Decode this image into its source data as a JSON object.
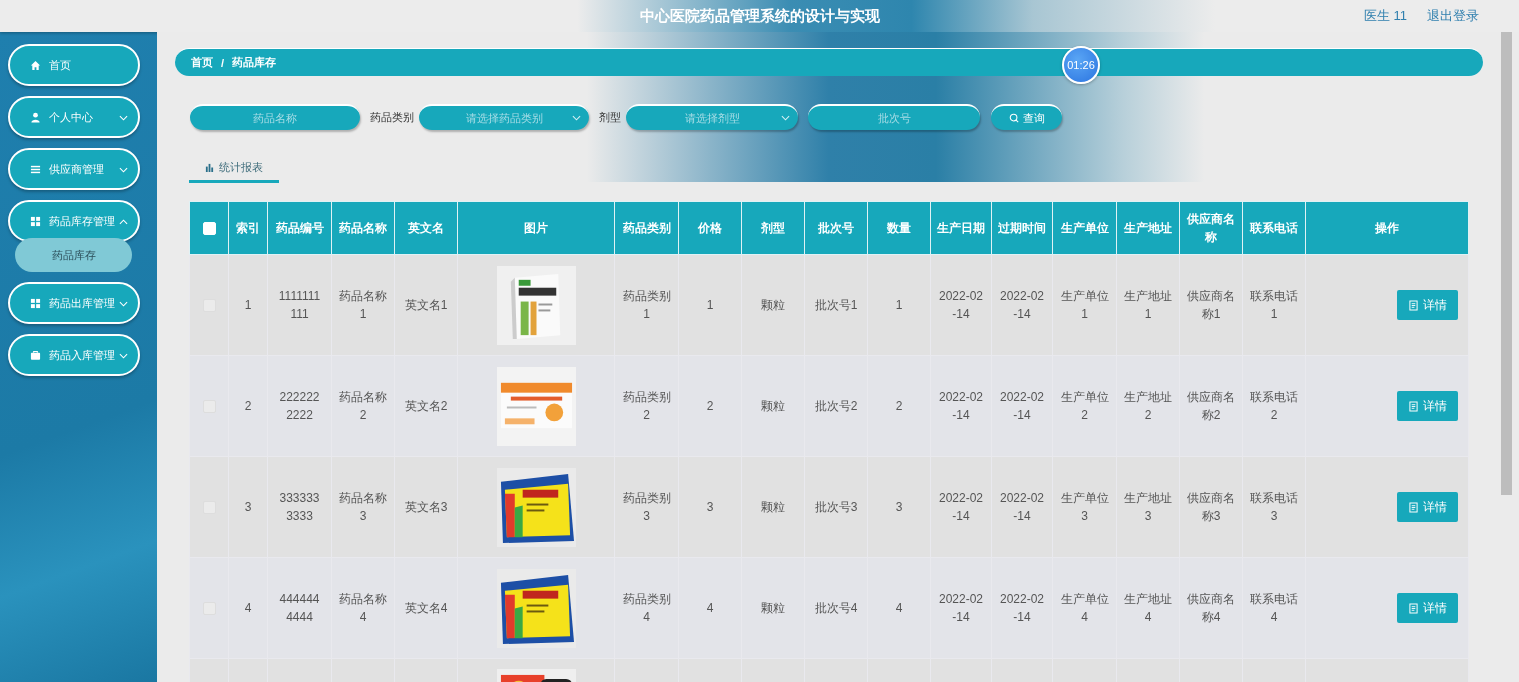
{
  "header": {
    "title": "中心医院药品管理系统的设计与实现",
    "user": "医生 11",
    "logout": "退出登录"
  },
  "sidebar": {
    "items": [
      {
        "label": "首页",
        "selected": false
      },
      {
        "label": "个人中心",
        "selected": false,
        "expanded": false
      },
      {
        "label": "供应商管理",
        "selected": false,
        "expanded": false
      },
      {
        "label": "药品库存管理",
        "selected": false,
        "expanded": true,
        "children": [
          {
            "label": "药品库存",
            "selected": true
          }
        ]
      },
      {
        "label": "药品出库管理",
        "selected": false,
        "expanded": false
      },
      {
        "label": "药品入库管理",
        "selected": false,
        "expanded": false
      }
    ]
  },
  "breadcrumb": [
    "首页",
    "药品库存"
  ],
  "breadcrumb_separator": "/",
  "timer": "01:26",
  "filters": {
    "name": {
      "placeholder": "药品名称"
    },
    "category_label": "药品类别",
    "category": {
      "placeholder": "请选择药品类别"
    },
    "form_label": "剂型",
    "form": {
      "placeholder": "请选择剂型"
    },
    "batch": {
      "placeholder": "批次号"
    },
    "search_button": "查询"
  },
  "tabs": [
    {
      "label": "统计报表",
      "selected": true
    }
  ],
  "table": {
    "header_checked": false,
    "columns": [
      "索引",
      "药品编号",
      "药品名称",
      "英文名",
      "图片",
      "药品类别",
      "价格",
      "剂型",
      "批次号",
      "数量",
      "生产日期",
      "过期时间",
      "生产单位",
      "生产地址",
      "供应商名称",
      "联系电话",
      "操作"
    ],
    "rows": [
      {
        "checked": false,
        "cells": [
          "1",
          "1111111111",
          "药品名称1",
          "英文名1",
          "",
          "药品类别1",
          "1",
          "颗粒",
          "批次号1",
          "1",
          "2022-02-14",
          "2022-02-14",
          "生产单位1",
          "生产地址1",
          "供应商名称1",
          "联系电话1"
        ],
        "action": "详情"
      },
      {
        "checked": false,
        "cells": [
          "2",
          "2222222222",
          "药品名称2",
          "英文名2",
          "",
          "药品类别2",
          "2",
          "颗粒",
          "批次号2",
          "2",
          "2022-02-14",
          "2022-02-14",
          "生产单位2",
          "生产地址2",
          "供应商名称2",
          "联系电话2"
        ],
        "action": "详情"
      },
      {
        "checked": false,
        "cells": [
          "3",
          "3333333333",
          "药品名称3",
          "英文名3",
          "",
          "药品类别3",
          "3",
          "颗粒",
          "批次号3",
          "3",
          "2022-02-14",
          "2022-02-14",
          "生产单位3",
          "生产地址3",
          "供应商名称3",
          "联系电话3"
        ],
        "action": "详情"
      },
      {
        "checked": false,
        "cells": [
          "4",
          "4444444444",
          "药品名称4",
          "英文名4",
          "",
          "药品类别4",
          "4",
          "颗粒",
          "批次号4",
          "4",
          "2022-02-14",
          "2022-02-14",
          "生产单位4",
          "生产地址4",
          "供应商名称4",
          "联系电话4"
        ],
        "action": "详情"
      }
    ]
  }
}
